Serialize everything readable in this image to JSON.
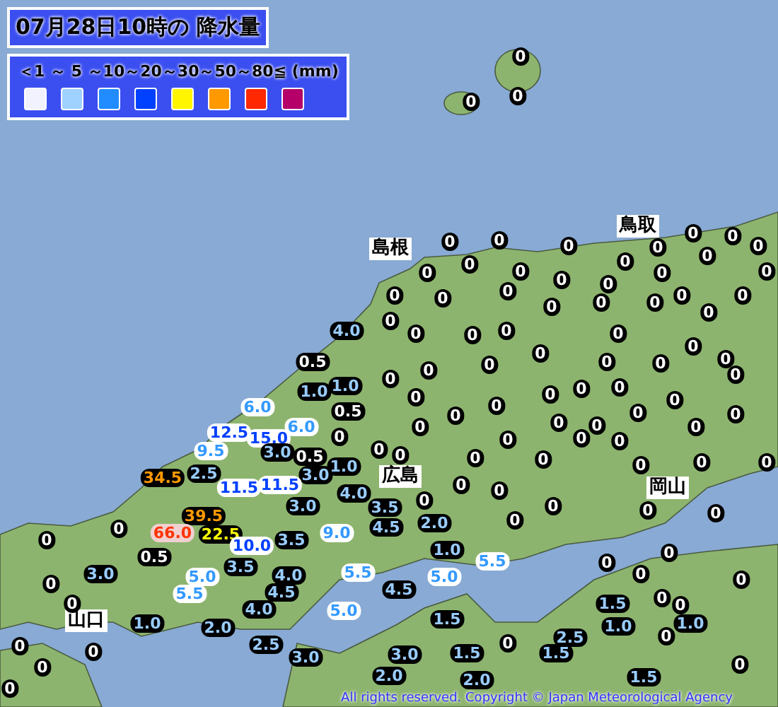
{
  "title": "07月28日10時の 降水量",
  "legend": {
    "scale": "＜1 ～ 5 ～10～20～30～50～80≦ (mm)",
    "swatches": [
      {
        "color": "#f2f2ff"
      },
      {
        "color": "#a0d2ff"
      },
      {
        "color": "#218cff"
      },
      {
        "color": "#0041ff"
      },
      {
        "color": "#fff500"
      },
      {
        "color": "#ff9900"
      },
      {
        "color": "#ff2800"
      },
      {
        "color": "#b40068"
      }
    ]
  },
  "places": [
    {
      "name": "島根"
    },
    {
      "name": "鳥取"
    },
    {
      "name": "広島"
    },
    {
      "name": "岡山"
    },
    {
      "name": "山口"
    }
  ],
  "stations": [
    {
      "value": "0",
      "kind": "trace"
    },
    {
      "value": "0",
      "kind": "trace"
    },
    {
      "value": "0",
      "kind": "trace"
    },
    {
      "value": "0",
      "kind": "trace"
    },
    {
      "value": "0",
      "kind": "trace"
    },
    {
      "value": "0",
      "kind": "trace"
    },
    {
      "value": "0",
      "kind": "trace"
    },
    {
      "value": "0",
      "kind": "trace"
    },
    {
      "value": "0",
      "kind": "trace"
    },
    {
      "value": "0",
      "kind": "trace"
    },
    {
      "value": "0",
      "kind": "trace"
    },
    {
      "value": "0",
      "kind": "trace"
    },
    {
      "value": "0",
      "kind": "trace"
    },
    {
      "value": "0",
      "kind": "trace"
    },
    {
      "value": "0",
      "kind": "trace"
    },
    {
      "value": "0",
      "kind": "trace"
    },
    {
      "value": "0",
      "kind": "trace"
    },
    {
      "value": "0",
      "kind": "trace"
    },
    {
      "value": "0",
      "kind": "trace"
    },
    {
      "value": "0",
      "kind": "trace"
    },
    {
      "value": "0",
      "kind": "trace"
    },
    {
      "value": "0",
      "kind": "trace"
    },
    {
      "value": "0",
      "kind": "trace"
    },
    {
      "value": "0",
      "kind": "trace"
    },
    {
      "value": "0",
      "kind": "trace"
    },
    {
      "value": "0",
      "kind": "trace"
    },
    {
      "value": "0",
      "kind": "trace"
    },
    {
      "value": "0",
      "kind": "trace"
    },
    {
      "value": "0",
      "kind": "trace"
    },
    {
      "value": "4.0",
      "kind": "light"
    },
    {
      "value": "0",
      "kind": "trace"
    },
    {
      "value": "0",
      "kind": "trace"
    },
    {
      "value": "0",
      "kind": "trace"
    },
    {
      "value": "0",
      "kind": "trace"
    },
    {
      "value": "0",
      "kind": "trace"
    },
    {
      "value": "0",
      "kind": "trace"
    },
    {
      "value": "0.5",
      "kind": "trace"
    },
    {
      "value": "0",
      "kind": "trace"
    },
    {
      "value": "0",
      "kind": "trace"
    },
    {
      "value": "0",
      "kind": "trace"
    },
    {
      "value": "0",
      "kind": "trace"
    },
    {
      "value": "0",
      "kind": "trace"
    },
    {
      "value": "0",
      "kind": "trace"
    },
    {
      "value": "0",
      "kind": "trace"
    },
    {
      "value": "1.0",
      "kind": "light"
    },
    {
      "value": "1.0",
      "kind": "light"
    },
    {
      "value": "0",
      "kind": "trace"
    },
    {
      "value": "0",
      "kind": "trace"
    },
    {
      "value": "0",
      "kind": "trace"
    },
    {
      "value": "0",
      "kind": "trace"
    },
    {
      "value": "0",
      "kind": "trace"
    },
    {
      "value": "0",
      "kind": "trace"
    },
    {
      "value": "6.0",
      "kind": "moderate"
    },
    {
      "value": "0.5",
      "kind": "trace"
    },
    {
      "value": "0",
      "kind": "trace"
    },
    {
      "value": "0",
      "kind": "trace"
    },
    {
      "value": "0",
      "kind": "trace"
    },
    {
      "value": "6.0",
      "kind": "moderate"
    },
    {
      "value": "0",
      "kind": "trace"
    },
    {
      "value": "0",
      "kind": "trace"
    },
    {
      "value": "0",
      "kind": "trace"
    },
    {
      "value": "0",
      "kind": "trace"
    },
    {
      "value": "12.5",
      "kind": "heavy"
    },
    {
      "value": "15.0",
      "kind": "heavy"
    },
    {
      "value": "0",
      "kind": "trace"
    },
    {
      "value": "0",
      "kind": "trace"
    },
    {
      "value": "0",
      "kind": "trace"
    },
    {
      "value": "0",
      "kind": "trace"
    },
    {
      "value": "9.5",
      "kind": "moderate"
    },
    {
      "value": "3.0",
      "kind": "light"
    },
    {
      "value": "0.5",
      "kind": "trace"
    },
    {
      "value": "0",
      "kind": "trace"
    },
    {
      "value": "0",
      "kind": "trace"
    },
    {
      "value": "0",
      "kind": "trace"
    },
    {
      "value": "0",
      "kind": "trace"
    },
    {
      "value": "0",
      "kind": "trace"
    },
    {
      "value": "0",
      "kind": "trace"
    },
    {
      "value": "0",
      "kind": "trace"
    },
    {
      "value": "34.5",
      "kind": "intense"
    },
    {
      "value": "2.5",
      "kind": "light"
    },
    {
      "value": "3.0",
      "kind": "light"
    },
    {
      "value": "1.0",
      "kind": "light"
    },
    {
      "value": "11.5",
      "kind": "heavy"
    },
    {
      "value": "11.5",
      "kind": "heavy"
    },
    {
      "value": "4.0",
      "kind": "light"
    },
    {
      "value": "0",
      "kind": "trace"
    },
    {
      "value": "0",
      "kind": "trace"
    },
    {
      "value": "39.5",
      "kind": "intense"
    },
    {
      "value": "3.0",
      "kind": "light"
    },
    {
      "value": "3.5",
      "kind": "light"
    },
    {
      "value": "0",
      "kind": "trace"
    },
    {
      "value": "0",
      "kind": "trace"
    },
    {
      "value": "0",
      "kind": "trace"
    },
    {
      "value": "0",
      "kind": "trace"
    },
    {
      "value": "2.0",
      "kind": "light"
    },
    {
      "value": "0",
      "kind": "trace"
    },
    {
      "value": "0",
      "kind": "trace"
    },
    {
      "value": "66.0",
      "kind": "extreme"
    },
    {
      "value": "22.5",
      "kind": "severe"
    },
    {
      "value": "9.0",
      "kind": "moderate"
    },
    {
      "value": "4.5",
      "kind": "light"
    },
    {
      "value": "0",
      "kind": "trace"
    },
    {
      "value": "10.0",
      "kind": "heavy"
    },
    {
      "value": "3.5",
      "kind": "light"
    },
    {
      "value": "0.5",
      "kind": "trace"
    },
    {
      "value": "1.0",
      "kind": "light"
    },
    {
      "value": "0",
      "kind": "trace"
    },
    {
      "value": "3.5",
      "kind": "light"
    },
    {
      "value": "5.5",
      "kind": "moderate"
    },
    {
      "value": "0",
      "kind": "trace"
    },
    {
      "value": "0",
      "kind": "trace"
    },
    {
      "value": "3.0",
      "kind": "light"
    },
    {
      "value": "5.0",
      "kind": "moderate"
    },
    {
      "value": "4.0",
      "kind": "light"
    },
    {
      "value": "5.5",
      "kind": "moderate"
    },
    {
      "value": "5.0",
      "kind": "moderate"
    },
    {
      "value": "0",
      "kind": "trace"
    },
    {
      "value": "0",
      "kind": "trace"
    },
    {
      "value": "0",
      "kind": "trace"
    },
    {
      "value": "5.5",
      "kind": "moderate"
    },
    {
      "value": "4.0",
      "kind": "light"
    },
    {
      "value": "4.5",
      "kind": "light"
    },
    {
      "value": "5.0",
      "kind": "moderate"
    },
    {
      "value": "4.5",
      "kind": "light"
    },
    {
      "value": "1.5",
      "kind": "light"
    },
    {
      "value": "0",
      "kind": "trace"
    },
    {
      "value": "0",
      "kind": "trace"
    },
    {
      "value": "1.0",
      "kind": "light"
    },
    {
      "value": "2.0",
      "kind": "light"
    },
    {
      "value": "1.5",
      "kind": "light"
    },
    {
      "value": "1.0",
      "kind": "light"
    },
    {
      "value": "1.0",
      "kind": "light"
    },
    {
      "value": "0",
      "kind": "trace"
    },
    {
      "value": "0",
      "kind": "trace"
    },
    {
      "value": "2.5",
      "kind": "light"
    },
    {
      "value": "3.0",
      "kind": "light"
    },
    {
      "value": "3.0",
      "kind": "light"
    },
    {
      "value": "1.5",
      "kind": "light"
    },
    {
      "value": "0",
      "kind": "trace"
    },
    {
      "value": "1.5",
      "kind": "light"
    },
    {
      "value": "2.5",
      "kind": "light"
    },
    {
      "value": "0",
      "kind": "trace"
    },
    {
      "value": "0",
      "kind": "trace"
    },
    {
      "value": "0",
      "kind": "trace"
    },
    {
      "value": "2.0",
      "kind": "light"
    },
    {
      "value": "1.5",
      "kind": "light"
    },
    {
      "value": "0",
      "kind": "trace"
    },
    {
      "value": "2.0",
      "kind": "light"
    }
  ],
  "copyright": "All rights reserved. Copyright © Japan Meteorological Agency"
}
